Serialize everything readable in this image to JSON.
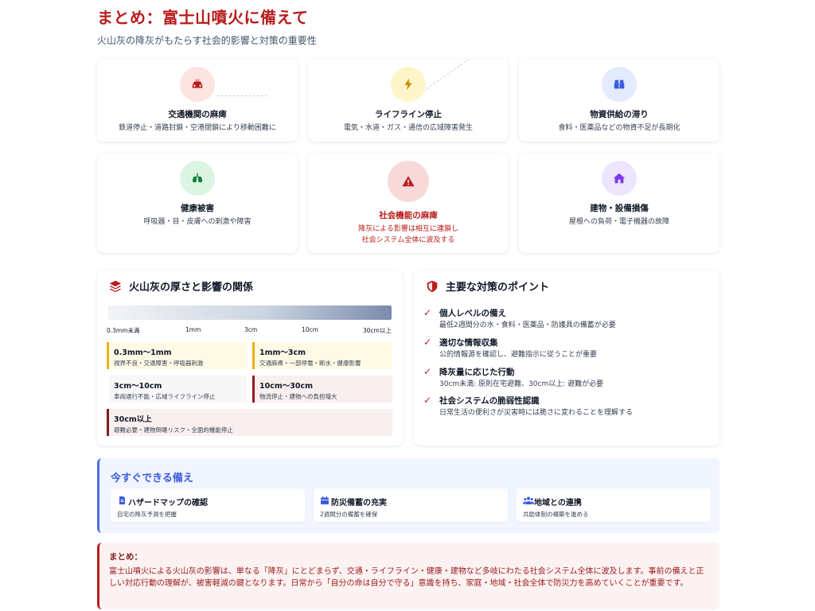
{
  "header": {
    "title": "まとめ：富士山噴火に備えて",
    "subtitle": "火山灰の降灰がもたらす社会的影響と対策の重要性"
  },
  "impacts": [
    {
      "title": "交通機関の麻痺",
      "desc": "鉄道停止・道路封鎖・空港閉鎖により移動困難に",
      "icon": "car-crash-icon",
      "color": "#c2410c"
    },
    {
      "title": "ライフライン停止",
      "desc": "電気・水道・ガス・通信の広域障害発生",
      "icon": "lightning-icon",
      "color": "#ca8a04"
    },
    {
      "title": "物資供給の滞り",
      "desc": "食料・医薬品などの物資不足が長期化",
      "icon": "boxes-icon",
      "color": "#3b5bdb"
    },
    {
      "title": "健康被害",
      "desc": "呼吸器・目・皮膚への刺激や障害",
      "icon": "lungs-icon",
      "color": "#15803d"
    },
    {
      "title": "社会機能の麻痺",
      "desc1": "降灰による影響は相互に連鎖し",
      "desc2": "社会システム全体に波及する",
      "icon": "warning-icon",
      "color": "#b91c1c"
    },
    {
      "title": "建物・設備損傷",
      "desc": "屋根への負荷・電子機器の故障",
      "icon": "house-icon",
      "color": "#7c3aed"
    }
  ],
  "thickness": {
    "title": "火山灰の厚さと影響の関係",
    "icon": "layers-icon",
    "ticks": [
      "0.3mm未満",
      "1mm",
      "3cm",
      "10cm",
      "30cm以上"
    ],
    "levels": [
      {
        "range": "0.3mm〜1mm",
        "desc": "視界不良・交通障害・呼吸器刺激",
        "color": "#eab308"
      },
      {
        "range": "1mm〜3cm",
        "desc": "交通麻痺・一部停電・断水・健康影響",
        "color": "#eab308"
      },
      {
        "range": "3cm〜10cm",
        "desc": "車両通行不能・広域ライフライン停止",
        "color": "#ffffff"
      },
      {
        "range": "10cm〜30cm",
        "desc": "物流停止・建物への負担増大",
        "color": "#991b1b"
      },
      {
        "range": "30cm以上",
        "desc": "避難必要・建物倒壊リスク・全面的機能停止",
        "color": "#7f1d1d"
      }
    ]
  },
  "measures": {
    "title": "主要な対策のポイント",
    "icon": "shield-icon",
    "items": [
      {
        "title": "個人レベルの備え",
        "desc": "最低2週間分の水・食料・医薬品・防護具の備蓄が必要"
      },
      {
        "title": "適切な情報収集",
        "desc": "公的情報源を確認し、避難指示に従うことが重要"
      },
      {
        "title": "降灰量に応じた行動",
        "desc": "30cm未満: 原則在宅避難、30cm以上: 避難が必要"
      },
      {
        "title": "社会システムの脆弱性認識",
        "desc": "日常生活の便利さが災害時には脆さに変わることを理解する"
      }
    ]
  },
  "preparation": {
    "title": "今すぐできる備え",
    "items": [
      {
        "label": "ハザードマップの確認",
        "desc": "自宅の降灰予測を把握",
        "icon": "document-icon"
      },
      {
        "label": "防災備蓄の充実",
        "desc": "2週間分の備蓄を確保",
        "icon": "calendar-icon"
      },
      {
        "label": "地域との連携",
        "desc": "共助体制の構築を進める",
        "icon": "people-icon"
      }
    ]
  },
  "summary": {
    "heading": "まとめ：",
    "body": "富士山噴火による火山灰の影響は、単なる「降灰」にとどまらず、交通・ライフライン・健康・建物など多岐にわたる社会システム全体に波及します。事前の備えと正しい対応行動の理解が、被害軽減の鍵となります。日常から「自分の命は自分で守る」意識を持ち、家庭・地域・社会全体で防災力を高めていくことが重要です。"
  },
  "colors": {
    "accent": "#b91c1c",
    "blue": "#3b5bdb"
  }
}
